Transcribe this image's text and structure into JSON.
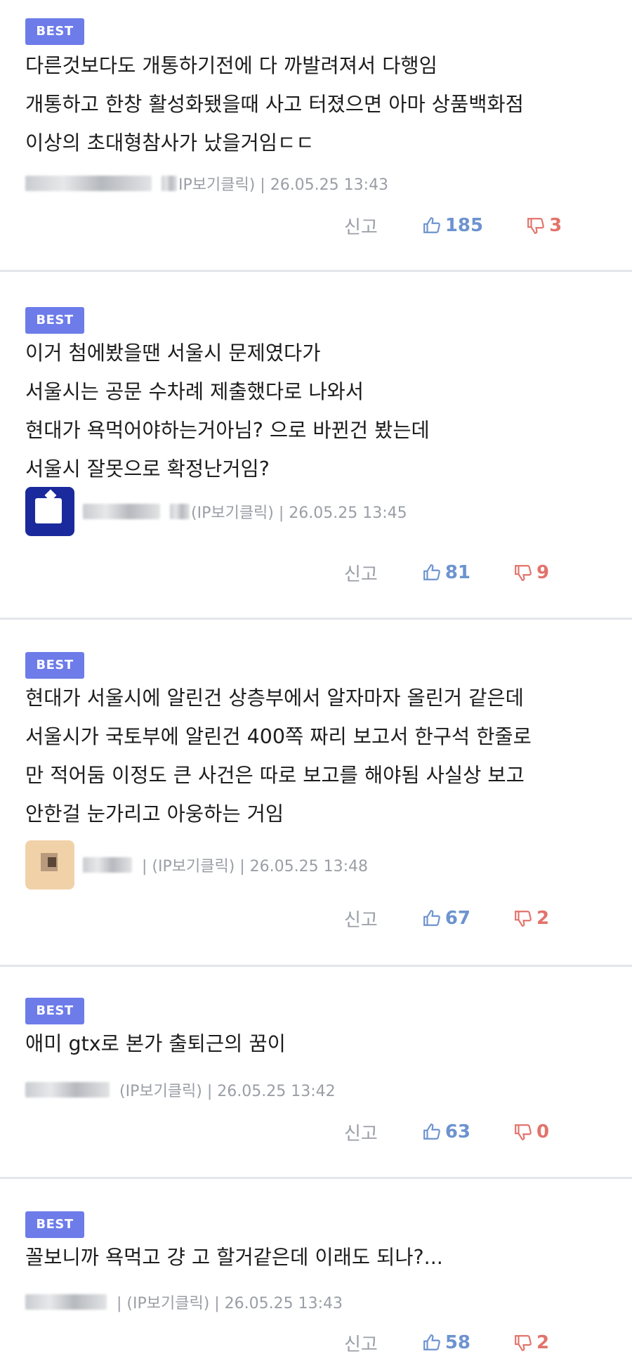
{
  "comments": [
    {
      "badge": "BEST",
      "lines": [
        "다른것보다도 개통하기전에 다 까발려져서 다행임",
        "개통하고 한창 활성화됐을때 사고 터졌으면 아마 상품백화점",
        "이상의 초대형참사가 났을거임ㄷㄷ"
      ],
      "meta": "IP보기클릭) | 26.05.25 13:43",
      "report": "신고",
      "likes": "185",
      "dislikes": "3"
    },
    {
      "badge": "BEST",
      "lines": [
        "이거 첨에봤을땐 서울시 문제였다가",
        "서울시는 공문 수차례 제출했다로 나와서",
        "현대가 욕먹어야하는거아님? 으로 바뀐건 봤는데",
        "서울시 잘못으로 확정난거임?"
      ],
      "meta": "(IP보기클릭) | 26.05.25 13:45",
      "report": "신고",
      "likes": "81",
      "dislikes": "9"
    },
    {
      "badge": "BEST",
      "lines": [
        "현대가 서울시에 알린건 상층부에서 알자마자 올린거 같은데",
        "서울시가 국토부에 알린건 400쪽 짜리 보고서 한구석 한줄로",
        "만 적어둠 이정도 큰 사건은 따로 보고를 해야됨 사실상 보고",
        "안한걸 눈가리고 아웅하는 거임"
      ],
      "meta": "| (IP보기클릭) | 26.05.25 13:48",
      "report": "신고",
      "likes": "67",
      "dislikes": "2"
    },
    {
      "badge": "BEST",
      "lines": [
        "애미 gtx로 본가 출퇴근의 꿈이"
      ],
      "meta": "(IP보기클릭) | 26.05.25 13:42",
      "report": "신고",
      "likes": "63",
      "dislikes": "0"
    },
    {
      "badge": "BEST",
      "lines": [
        "꼴보니까 욕먹고 걍 고 할거같은데 이래도 되나?..."
      ],
      "meta": "| (IP보기클릭) | 26.05.25 13:43",
      "report": "신고",
      "likes": "58",
      "dislikes": "2"
    }
  ],
  "colors": {
    "badge": "#6d7ce9",
    "like": "#6d93cf",
    "dislike": "#e2736c",
    "muted": "#9a9ea5"
  },
  "icons": {
    "like": "thumbs-up-icon",
    "dislike": "thumbs-down-icon"
  }
}
